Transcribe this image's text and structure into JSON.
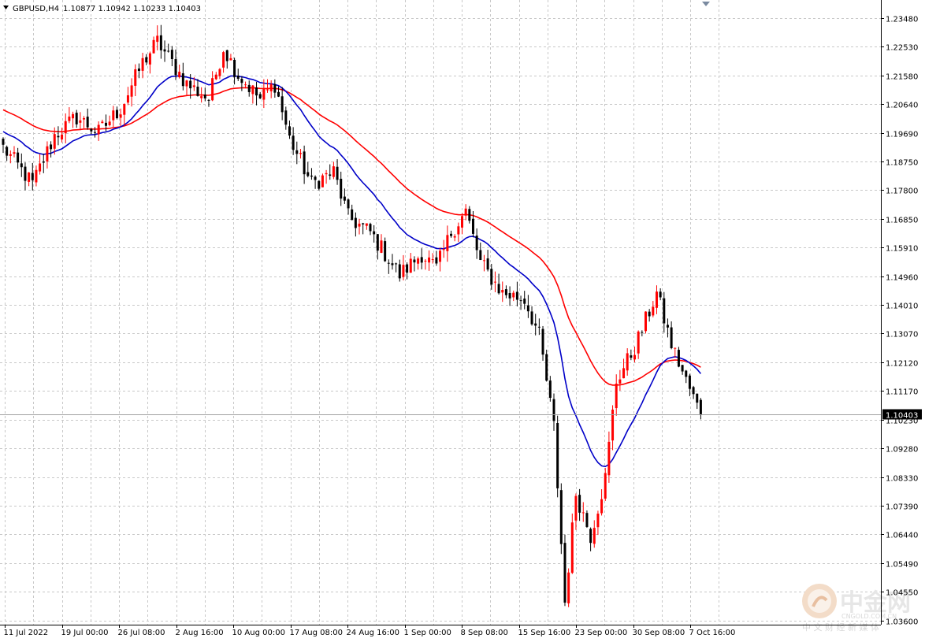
{
  "header": {
    "symbol": "GBPUSD,H4",
    "ohlc": "1.10877 1.10942 1.10233 1.10403"
  },
  "colors": {
    "background": "#ffffff",
    "grid": "#c8c8c8",
    "bull_candle": "#ff0000",
    "bear_candle": "#000000",
    "ma_fast": "#0000c8",
    "ma_slow": "#ff0000",
    "price_line": "#a0a0a0",
    "price_tag_bg": "#000000",
    "price_tag_text": "#ffffff",
    "watermark": "#e6e6e6"
  },
  "watermark": {
    "brand": "中金网",
    "url": "CNGOLD.COM.CN",
    "slogan": "中 文 财 经 新 媒 体",
    "icon": "coin-logo-icon"
  },
  "chart_data": {
    "type": "candlestick",
    "timeframe": "H4",
    "grid": true,
    "ylim": [
      1.0346,
      1.2407
    ],
    "y_ticks": [
      "1.23480",
      "1.22530",
      "1.21580",
      "1.20640",
      "1.19690",
      "1.18750",
      "1.17800",
      "1.16850",
      "1.15910",
      "1.14960",
      "1.14010",
      "1.13070",
      "1.12120",
      "1.11170",
      "1.10230",
      "1.09280",
      "1.08330",
      "1.07390",
      "1.06440",
      "1.05490",
      "1.04550",
      "1.03600"
    ],
    "x_labels": [
      "11 Jul 2022",
      "19 Jul 00:00",
      "26 Jul 08:00",
      "2 Aug 16:00",
      "10 Aug 00:00",
      "17 Aug 08:00",
      "24 Aug 16:00",
      "1 Sep 00:00",
      "8 Sep 08:00",
      "15 Sep 16:00",
      "23 Sep 00:00",
      "30 Sep 08:00",
      "7 Oct 16:00"
    ],
    "current_price": "1.10403",
    "key_closes": [
      {
        "label": "11 Jul 2022",
        "close": 1.191
      },
      {
        "label": "19 Jul 00:00",
        "close": 1.198
      },
      {
        "label": "26 Jul 08:00",
        "close": 1.221
      },
      {
        "label": "2 Aug 16:00",
        "close": 1.212
      },
      {
        "label": "10 Aug 00:00",
        "close": 1.221
      },
      {
        "label": "17 Aug 08:00",
        "close": 1.189
      },
      {
        "label": "24 Aug 16:00",
        "close": 1.166
      },
      {
        "label": "1 Sep 00:00",
        "close": 1.152
      },
      {
        "label": "8 Sep 08:00",
        "close": 1.17
      },
      {
        "label": "15 Sep 16:00",
        "close": 1.14
      },
      {
        "label": "23 Sep 00:00",
        "close": 1.086
      },
      {
        "label": "30 Sep 08:00",
        "close": 1.14
      },
      {
        "label": "7 Oct 16:00",
        "close": 1.104
      }
    ],
    "anchors": [
      [
        0,
        1.192
      ],
      [
        8,
        1.18
      ],
      [
        14,
        1.196
      ],
      [
        20,
        1.202
      ],
      [
        26,
        1.197
      ],
      [
        32,
        1.205
      ],
      [
        38,
        1.22
      ],
      [
        42,
        1.227
      ],
      [
        50,
        1.213
      ],
      [
        56,
        1.208
      ],
      [
        60,
        1.225
      ],
      [
        64,
        1.216
      ],
      [
        70,
        1.208
      ],
      [
        74,
        1.213
      ],
      [
        78,
        1.195
      ],
      [
        84,
        1.18
      ],
      [
        90,
        1.184
      ],
      [
        94,
        1.169
      ],
      [
        100,
        1.164
      ],
      [
        108,
        1.15
      ],
      [
        114,
        1.157
      ],
      [
        118,
        1.152
      ],
      [
        122,
        1.164
      ],
      [
        126,
        1.171
      ],
      [
        130,
        1.154
      ],
      [
        136,
        1.144
      ],
      [
        142,
        1.142
      ],
      [
        146,
        1.13
      ],
      [
        150,
        1.1
      ],
      [
        153,
        1.042
      ],
      [
        156,
        1.078
      ],
      [
        160,
        1.064
      ],
      [
        164,
        1.083
      ],
      [
        167,
        1.115
      ],
      [
        172,
        1.126
      ],
      [
        178,
        1.144
      ],
      [
        182,
        1.127
      ],
      [
        186,
        1.115
      ],
      [
        190,
        1.104
      ]
    ],
    "ma_fast_period": 21,
    "ma_slow_period": 50
  }
}
